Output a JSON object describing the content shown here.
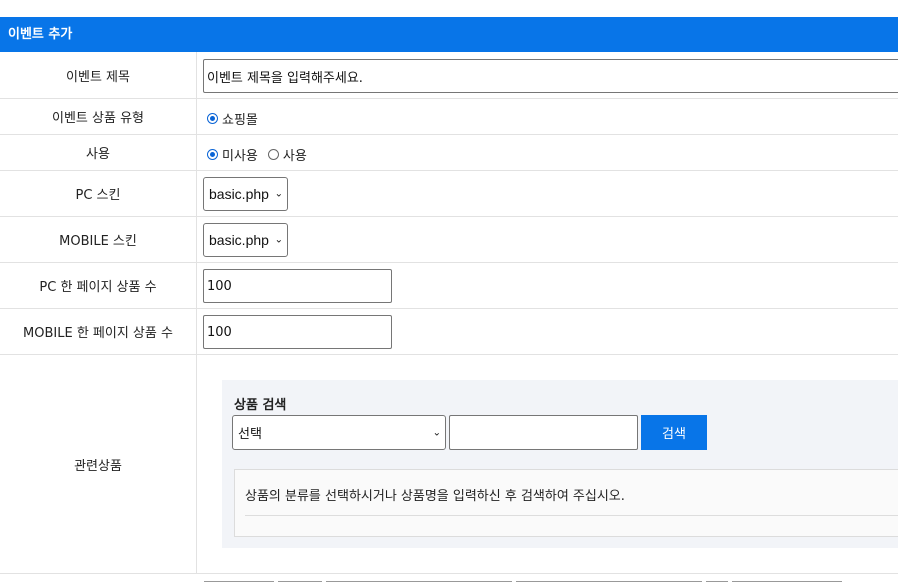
{
  "header": {
    "title": "이벤트 추가"
  },
  "form": {
    "event_title": {
      "label": "이벤트 제목",
      "value": "이벤트 제목을 입력해주세요."
    },
    "product_type": {
      "label": "이벤트 상품 유형",
      "option": "쇼핑몰"
    },
    "usage": {
      "label": "사용",
      "option_unused": "미사용",
      "option_used": "사용"
    },
    "pc_skin": {
      "label": "PC 스킨",
      "value": "basic.php"
    },
    "mobile_skin": {
      "label": "MOBILE 스킨",
      "value": "basic.php"
    },
    "pc_per_page": {
      "label": "PC 한 페이지 상품 수",
      "value": "100"
    },
    "mobile_per_page": {
      "label": "MOBILE 한 페이지 상품 수",
      "value": "100"
    },
    "related": {
      "label": "관련상품",
      "search_title": "상품 검색",
      "select_value": "선택",
      "search_button": "검색",
      "notice": "상품의 분류를 선택하시거나 상품명을 입력하신 후 검색하여 주십시오."
    }
  }
}
